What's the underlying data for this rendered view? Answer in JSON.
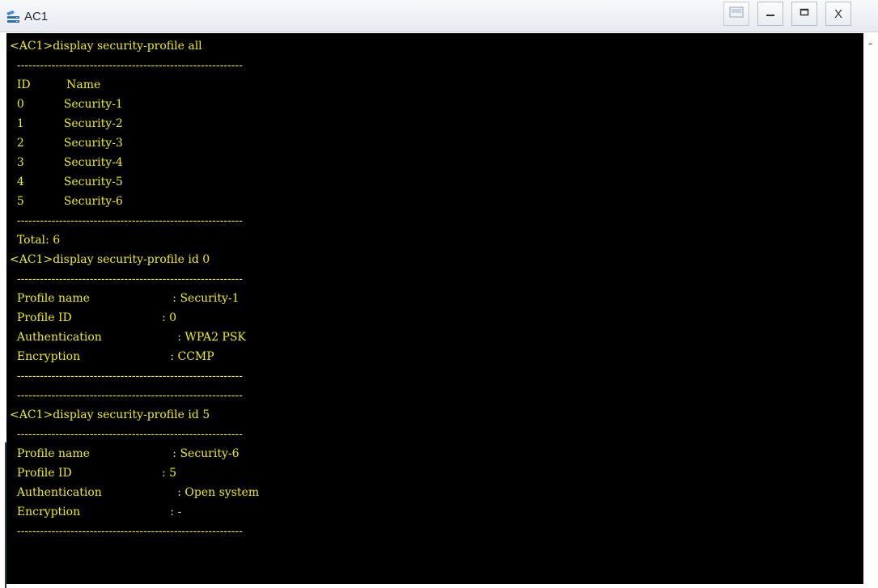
{
  "window": {
    "title": "AC1",
    "close_label": "X"
  },
  "terminal": {
    "lines": [
      "<AC1>display security-profile all",
      "  -----------------------------------------------------------",
      "  ID          Name",
      "  0           Security-1",
      "  1           Security-2",
      "  2           Security-3",
      "  3           Security-4",
      "  4           Security-5",
      "  5           Security-6",
      "  -----------------------------------------------------------",
      "  Total: 6",
      "<AC1>display security-profile id 0",
      "  -----------------------------------------------------------",
      "  Profile name                       : Security-1",
      "  Profile ID                         : 0",
      "  Authentication                     : WPA2 PSK",
      "  Encryption                         : CCMP",
      "  -----------------------------------------------------------",
      "  -----------------------------------------------------------",
      "<AC1>display security-profile id 5",
      "  -----------------------------------------------------------",
      "  Profile name                       : Security-6",
      "  Profile ID                         : 5",
      "  Authentication                     : Open system",
      "  Encryption                         : -",
      "  -----------------------------------------------------------"
    ]
  },
  "colors": {
    "terminal_bg": "#000000",
    "terminal_text": "#f0f000"
  }
}
